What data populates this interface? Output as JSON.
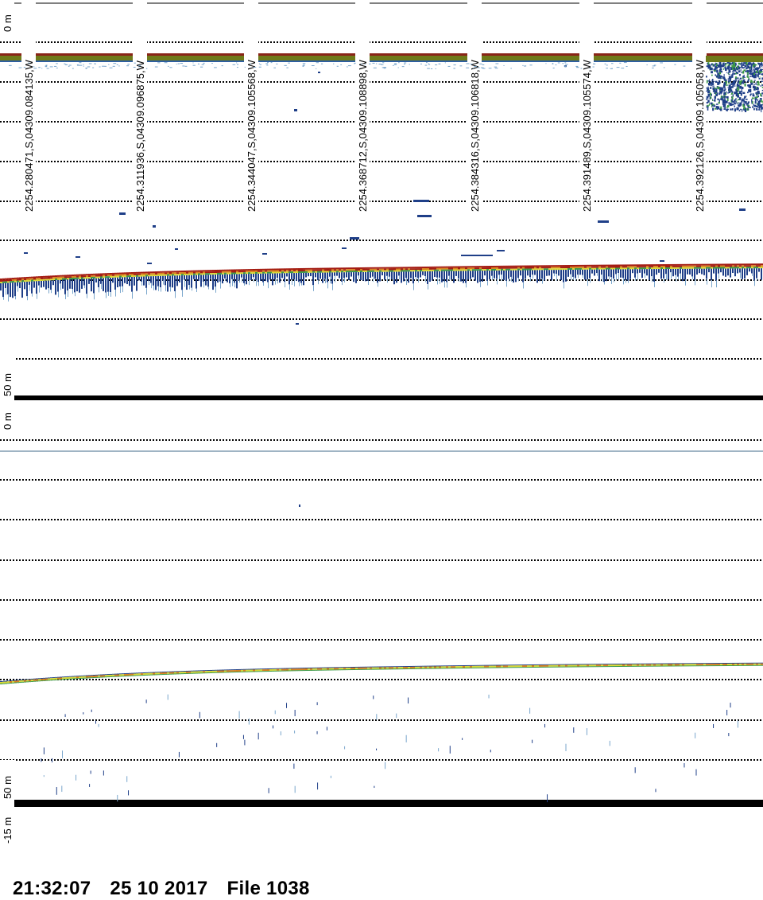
{
  "echogram": {
    "top_panel": {
      "depth_start_label": "0 m",
      "depth_end_label": "50 m",
      "position_labels": [
        "2254.280471,S,04309.084135,W",
        "2254.311936,S,04309.096875,W",
        "2254.344047,S,04309.105568,W",
        "2254.368712,S,04309.108898,W",
        "2254.384316,S,04309.106818,W",
        "2254.391489,S,04309.105574,W",
        "2254.392126,S,04309.105058,W"
      ]
    },
    "bottom_panel": {
      "depth_start_label": "0 m",
      "depth_end_label": "50 m",
      "offset_label": "-15 m"
    }
  },
  "footer": {
    "time": "21:32:07",
    "date": "25 10 2017",
    "file": "File 1038"
  },
  "colors": {
    "grid": "#000000",
    "surface_band_top": "#4b3a10",
    "surface_band": "#6f7a1a",
    "echo_red": "#a41c12",
    "echo_orange": "#d8821e",
    "echo_yellow": "#d8d838",
    "echo_green": "#3d9a46",
    "echo_blue": "#1f3f88",
    "echo_light": "#7aa6cc"
  }
}
